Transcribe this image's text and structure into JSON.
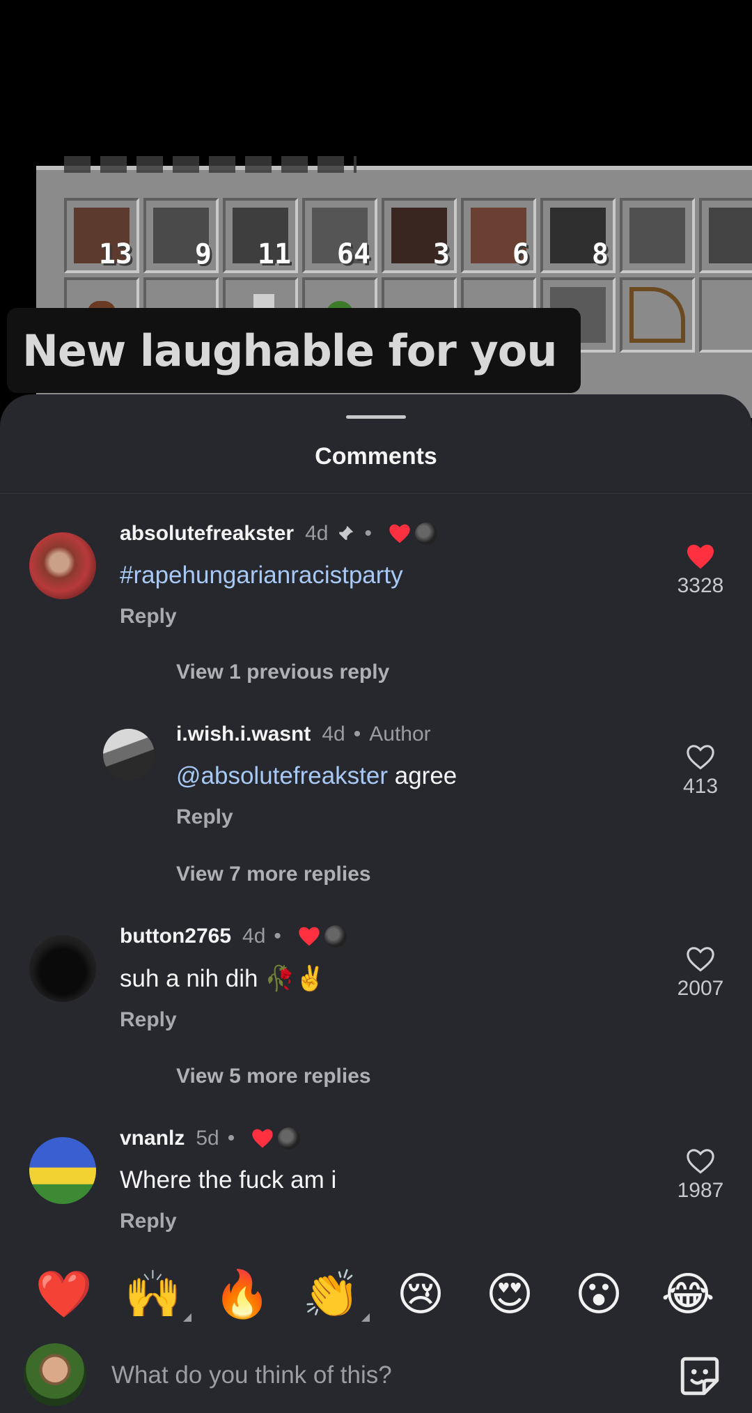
{
  "video": {
    "caption": "New laughable for you",
    "slot_counts": [
      "13",
      "9",
      "11",
      "64",
      "3",
      "6",
      "8",
      "",
      ""
    ]
  },
  "sheet": {
    "title": "Comments"
  },
  "comments": [
    {
      "username": "absolutefreakster",
      "time": "4d",
      "dot": "•",
      "text_prefix": "",
      "mention": "",
      "hashtag": "#rapehungarianracistparty",
      "text_suffix": "",
      "reply_label": "Reply",
      "likes": "3328",
      "liked": true
    },
    {
      "username": "i.wish.i.wasnt",
      "time": "4d",
      "dot": "•",
      "author_label": "Author",
      "mention": "@absolutefreakster",
      "text_suffix": " agree",
      "reply_label": "Reply",
      "likes": "413",
      "liked": false
    },
    {
      "username": "button2765",
      "time": "4d",
      "dot": "•",
      "text": "suh a nih dih 🥀✌️",
      "reply_label": "Reply",
      "likes": "2007",
      "liked": false
    },
    {
      "username": "vnanlz",
      "time": "5d",
      "dot": "•",
      "text": "Where the fuck am i",
      "reply_label": "Reply",
      "likes": "1987",
      "liked": false
    }
  ],
  "view_links": {
    "previous": "View 1 previous reply",
    "more_7": "View 7 more replies",
    "more_5": "View 5 more replies"
  },
  "reactions": [
    {
      "emoji": "❤️",
      "icon": "heart-emoji-icon"
    },
    {
      "emoji": "🙌",
      "icon": "raising-hands-emoji-icon"
    },
    {
      "emoji": "🔥",
      "icon": "fire-emoji-icon"
    },
    {
      "emoji": "👏",
      "icon": "clapping-hands-emoji-icon"
    },
    {
      "emoji": "😢",
      "icon": "crying-face-emoji-icon"
    },
    {
      "emoji": "😍",
      "icon": "heart-eyes-emoji-icon"
    },
    {
      "emoji": "😮",
      "icon": "surprised-face-emoji-icon"
    },
    {
      "emoji": "😂",
      "icon": "tears-of-joy-emoji-icon"
    }
  ],
  "input": {
    "placeholder": "What do you think of this?"
  },
  "colors": {
    "sheet_bg": "#26282e",
    "like_red": "#ff3040",
    "link_blue": "#a8c9f5"
  }
}
